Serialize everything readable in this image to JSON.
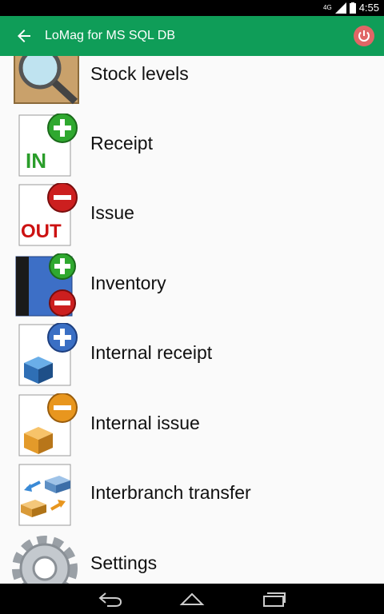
{
  "status_bar": {
    "network": "4G",
    "time": "4:55"
  },
  "app_bar": {
    "title": "LoMag for MS SQL DB",
    "back_icon": "arrow-back-icon",
    "power_icon": "power-icon"
  },
  "menu": [
    {
      "label": "Stock levels",
      "icon": "magnifier-box-icon"
    },
    {
      "label": "Receipt",
      "icon": "receipt-in-icon"
    },
    {
      "label": "Issue",
      "icon": "issue-out-icon"
    },
    {
      "label": "Inventory",
      "icon": "inventory-book-icon"
    },
    {
      "label": "Internal receipt",
      "icon": "internal-receipt-icon"
    },
    {
      "label": "Internal issue",
      "icon": "internal-issue-icon"
    },
    {
      "label": "Interbranch transfer",
      "icon": "transfer-icon"
    },
    {
      "label": "Settings",
      "icon": "gear-icon"
    }
  ],
  "colors": {
    "app_bar": "#0f9d58",
    "background": "#fafafa"
  }
}
